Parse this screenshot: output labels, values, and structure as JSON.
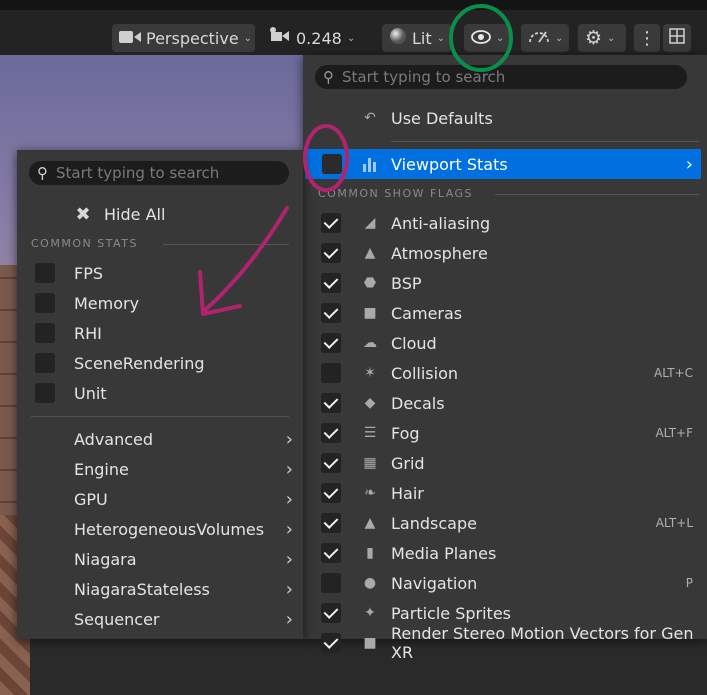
{
  "toolbar": {
    "view_mode": "Perspective",
    "camera_speed": "0.248",
    "lighting_mode": "Lit"
  },
  "show_menu": {
    "search_placeholder": "Start typing to search",
    "use_defaults": "Use Defaults",
    "viewport_stats": "Viewport Stats",
    "section_common": "COMMON SHOW FLAGS",
    "flags": [
      {
        "label": "Anti-aliasing",
        "checked": true,
        "shortcut": ""
      },
      {
        "label": "Atmosphere",
        "checked": true,
        "shortcut": ""
      },
      {
        "label": "BSP",
        "checked": true,
        "shortcut": ""
      },
      {
        "label": "Cameras",
        "checked": true,
        "shortcut": ""
      },
      {
        "label": "Cloud",
        "checked": true,
        "shortcut": ""
      },
      {
        "label": "Collision",
        "checked": false,
        "shortcut": "ALT+C"
      },
      {
        "label": "Decals",
        "checked": true,
        "shortcut": ""
      },
      {
        "label": "Fog",
        "checked": true,
        "shortcut": "ALT+F"
      },
      {
        "label": "Grid",
        "checked": true,
        "shortcut": ""
      },
      {
        "label": "Hair",
        "checked": true,
        "shortcut": ""
      },
      {
        "label": "Landscape",
        "checked": true,
        "shortcut": "ALT+L"
      },
      {
        "label": "Media Planes",
        "checked": true,
        "shortcut": ""
      },
      {
        "label": "Navigation",
        "checked": false,
        "shortcut": "P"
      },
      {
        "label": "Particle Sprites",
        "checked": true,
        "shortcut": ""
      },
      {
        "label": "Render Stereo Motion Vectors for Gen XR",
        "checked": true,
        "shortcut": ""
      }
    ]
  },
  "stats_menu": {
    "search_placeholder": "Start typing to search",
    "hide_all": "Hide All",
    "section_common": "COMMON STATS",
    "common": [
      "FPS",
      "Memory",
      "RHI",
      "SceneRendering",
      "Unit"
    ],
    "submenus": [
      "Advanced",
      "Engine",
      "GPU",
      "HeterogeneousVolumes",
      "Niagara",
      "NiagaraStateless",
      "Sequencer"
    ]
  },
  "colors": {
    "highlight": "#0070e0",
    "annotation_green": "#0a8f4a",
    "annotation_magenta": "#b0236f"
  }
}
